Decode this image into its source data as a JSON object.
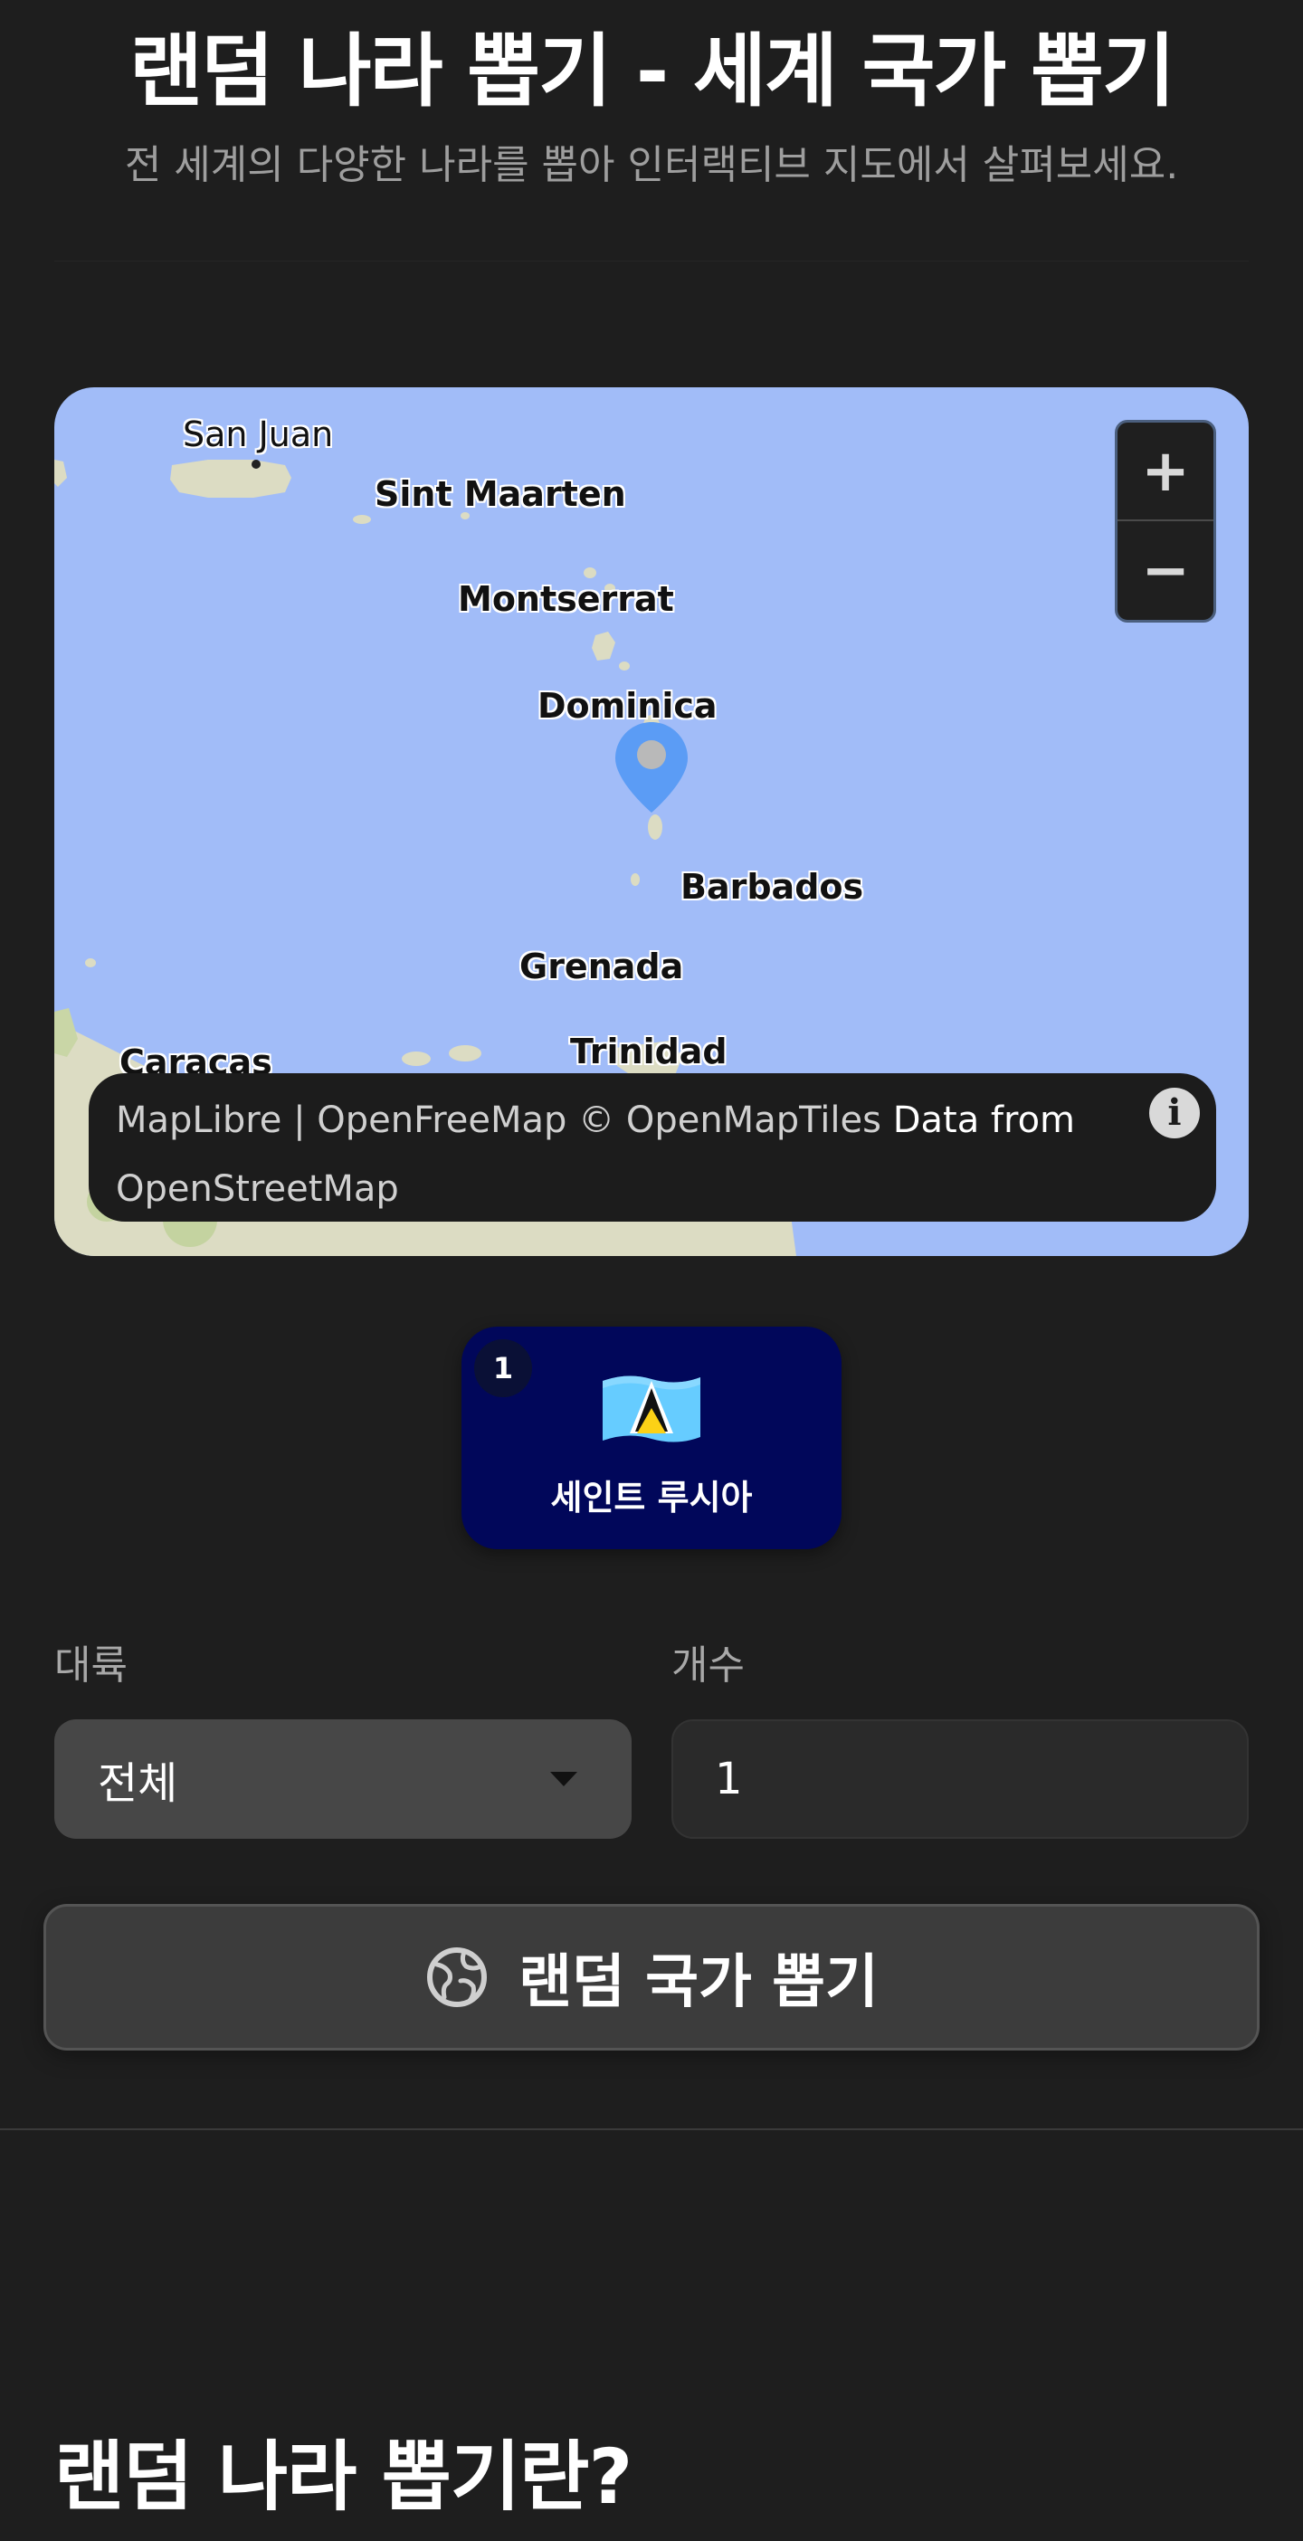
{
  "header": {
    "title": "랜덤 나라 뽑기 - 세계 국가 뽑기",
    "subtitle": "전 세계의 다양한 나라를 뽑아 인터랙티브 지도에서 살펴보세요."
  },
  "map": {
    "places": {
      "san_juan": "San Juan",
      "sint_maarten": "Sint Maarten",
      "montserrat": "Montserrat",
      "dominica": "Dominica",
      "barbados": "Barbados",
      "grenada": "Grenada",
      "caracas": "Caracas",
      "trinidad": "Trinidad"
    },
    "zoom_in_label": "+",
    "zoom_out_label": "−",
    "attribution": {
      "links": "MapLibre | OpenFreeMap © OpenMapTiles",
      "data_text": "Data from",
      "osm": "OpenStreetMap"
    },
    "info_label": "i",
    "water_color": "#a1bcf8",
    "land_color": "#dcdcc3",
    "marker_color": "#5b9cf5"
  },
  "result": {
    "index": "1",
    "flag": "saint-lucia-flag",
    "country_name": "세인트 루시아",
    "card_color": "#01075a"
  },
  "form": {
    "continent_label": "대륙",
    "continent_value": "전체",
    "count_label": "개수",
    "count_value": "1"
  },
  "actions": {
    "draw_button": "랜덤 국가 뽑기",
    "draw_icon": "globe-icon"
  },
  "section": {
    "title": "랜덤 나라 뽑기란?"
  }
}
